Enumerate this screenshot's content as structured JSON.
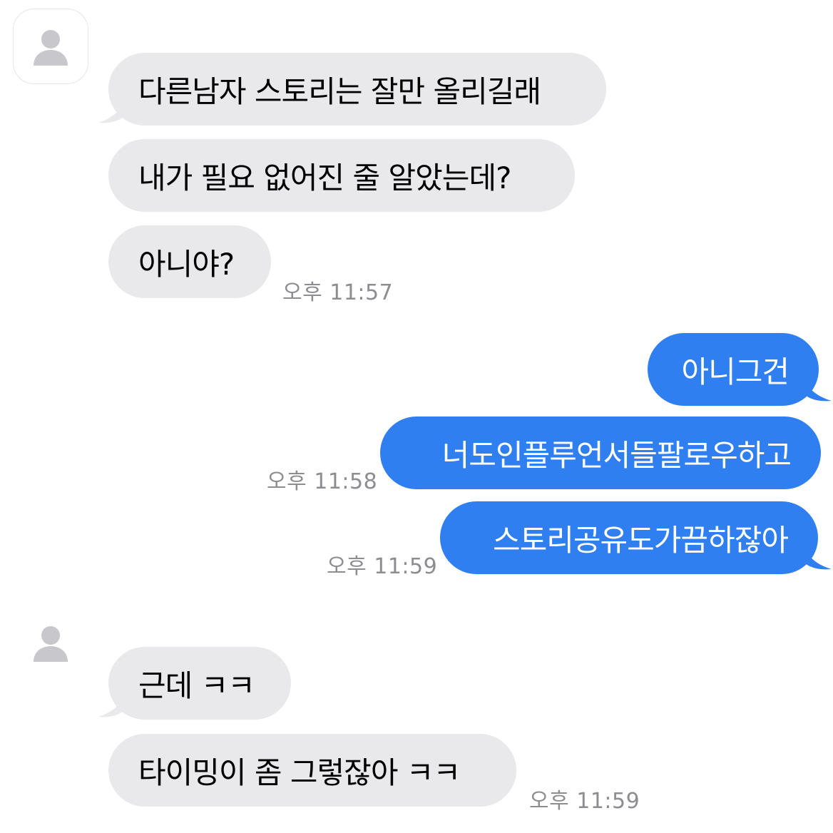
{
  "colors": {
    "incoming_bubble": "#e9e9eb",
    "outgoing_bubble": "#2f7ff0",
    "timestamp": "#8c8c91",
    "avatar": "#c7c7cc"
  },
  "icons": {
    "avatar": "person-silhouette-icon"
  },
  "conversation": {
    "group1": {
      "messages": [
        "다른남자 스토리는 잘만 올리길래",
        "내가 필요 없어진 줄 알았는데?",
        "아니야?"
      ],
      "timestamp": "오후 11:57"
    },
    "group2": {
      "messages": [
        "아니그건",
        "너도인플루언서들팔로우하고",
        "스토리공유도가끔하잖아"
      ],
      "timestamps": [
        "오후 11:58",
        "오후 11:59"
      ]
    },
    "group3": {
      "messages": [
        "근데 ㅋㅋ",
        "타이밍이 좀 그렇잖아 ㅋㅋ"
      ],
      "timestamp": "오후 11:59"
    }
  }
}
